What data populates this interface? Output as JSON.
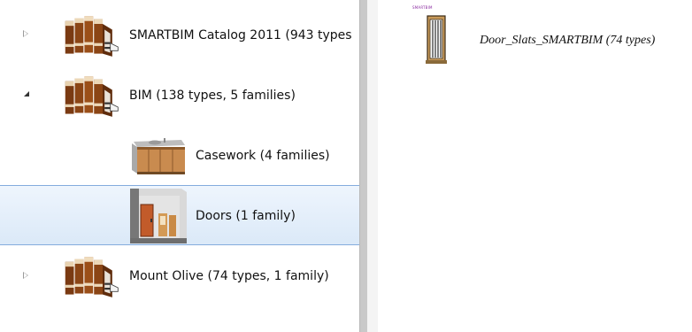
{
  "tree": {
    "items": [
      {
        "label": "SMARTBIM Catalog 2011  (943 types",
        "icon": "books-icon",
        "expander": "collapsed"
      },
      {
        "label": "BIM  (138 types, 5 families)",
        "icon": "books-icon",
        "expander": "expanded"
      },
      {
        "label": "Casework  (4 families)",
        "icon": "casework-icon",
        "expander": "none"
      },
      {
        "label": "Doors  (1 family)",
        "icon": "doors-icon",
        "expander": "none",
        "selected": true
      },
      {
        "label": "Mount Olive  (74 types, 1 family)",
        "icon": "books-icon",
        "expander": "collapsed"
      }
    ]
  },
  "content": {
    "items": [
      {
        "label": "Door_Slats_SMARTBIM  (74 types)",
        "brand": "SMARTBIM",
        "icon": "door-icon"
      }
    ]
  },
  "colors": {
    "selection": "#dbe9f8",
    "selection_border": "#84acdd",
    "splitter": "#c9c9c9"
  }
}
